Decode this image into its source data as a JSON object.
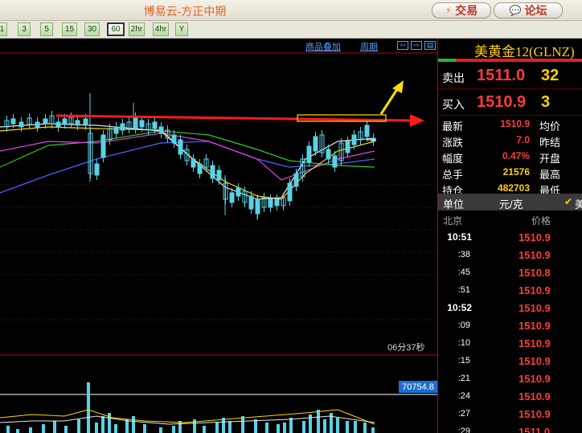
{
  "app_title": "博易云-方正中期",
  "top_buttons": {
    "trade": {
      "icon": "lightning-icon",
      "label": "交易"
    },
    "forum": {
      "icon": "chat-bubble-icon",
      "label": "论坛"
    }
  },
  "period_buttons": [
    "1",
    "3",
    "5",
    "15",
    "30",
    "60",
    "2hr",
    "4hr",
    "Y"
  ],
  "active_period": "60",
  "chart_toolbar": {
    "overlay_label": "商品叠加",
    "period_label": "周期",
    "nav_icons": [
      "scroll-left-icon",
      "scroll-right-icon",
      "layout-icon"
    ]
  },
  "countdown": "06分37秒",
  "volume_marker": "70754.8",
  "colors": {
    "up_candle": "#5ad2e6",
    "down_candle": "#5ad2e6",
    "ma_white": "#e8e8e8",
    "ma_yellow": "#ffd800",
    "ma_magenta": "#e040e0",
    "ma_green": "#2ccb2c",
    "ma_blue": "#4a64ff",
    "annotation_red": "#ff1a1a",
    "annotation_yellow": "#ffdd00",
    "price_red": "#ff3a3a"
  },
  "panel": {
    "symbol": "美黄金12(GLNZ)",
    "sell": {
      "label": "卖出",
      "price": "1511.0",
      "volume": "32"
    },
    "buy": {
      "label": "买入",
      "price": "1510.9",
      "volume": "3"
    },
    "stats": [
      {
        "k1": "最新",
        "v1": "1510.9",
        "v1_color": "#ff3a3a",
        "k2": "均价"
      },
      {
        "k1": "涨跌",
        "v1": "7.0",
        "v1_color": "#ff3a3a",
        "k2": "昨结"
      },
      {
        "k1": "幅度",
        "v1": "0.47%",
        "v1_color": "#ff3a3a",
        "k2": "开盘"
      },
      {
        "k1": "总手",
        "v1": "21576",
        "v1_color": "#ffd000",
        "k2": "最高"
      },
      {
        "k1": "持仓",
        "v1": "482703",
        "v1_color": "#ffd000",
        "k2": "最低"
      }
    ],
    "unit_label": "单位",
    "unit_value": "元/克",
    "unit_check_icon": "checkmark-icon",
    "unit_trailing": "美",
    "tick_header": {
      "location": "北京",
      "price": "价格"
    },
    "ticks": [
      {
        "time": "10:51",
        "price": "1510.9",
        "bold": true
      },
      {
        "time": ":38",
        "price": "1510.9",
        "bold": false
      },
      {
        "time": ":45",
        "price": "1510.8",
        "bold": false
      },
      {
        "time": ":51",
        "price": "1510.9",
        "bold": false
      },
      {
        "time": "10:52",
        "price": "1510.9",
        "bold": true
      },
      {
        "time": ":09",
        "price": "1510.9",
        "bold": false
      },
      {
        "time": ":10",
        "price": "1510.9",
        "bold": false
      },
      {
        "time": ":15",
        "price": "1510.9",
        "bold": false
      },
      {
        "time": ":21",
        "price": "1510.9",
        "bold": false
      },
      {
        "time": ":24",
        "price": "1510.9",
        "bold": false
      },
      {
        "time": ":27",
        "price": "1510.9",
        "bold": false
      },
      {
        "time": ":29",
        "price": "1511.0",
        "bold": false
      }
    ]
  }
}
